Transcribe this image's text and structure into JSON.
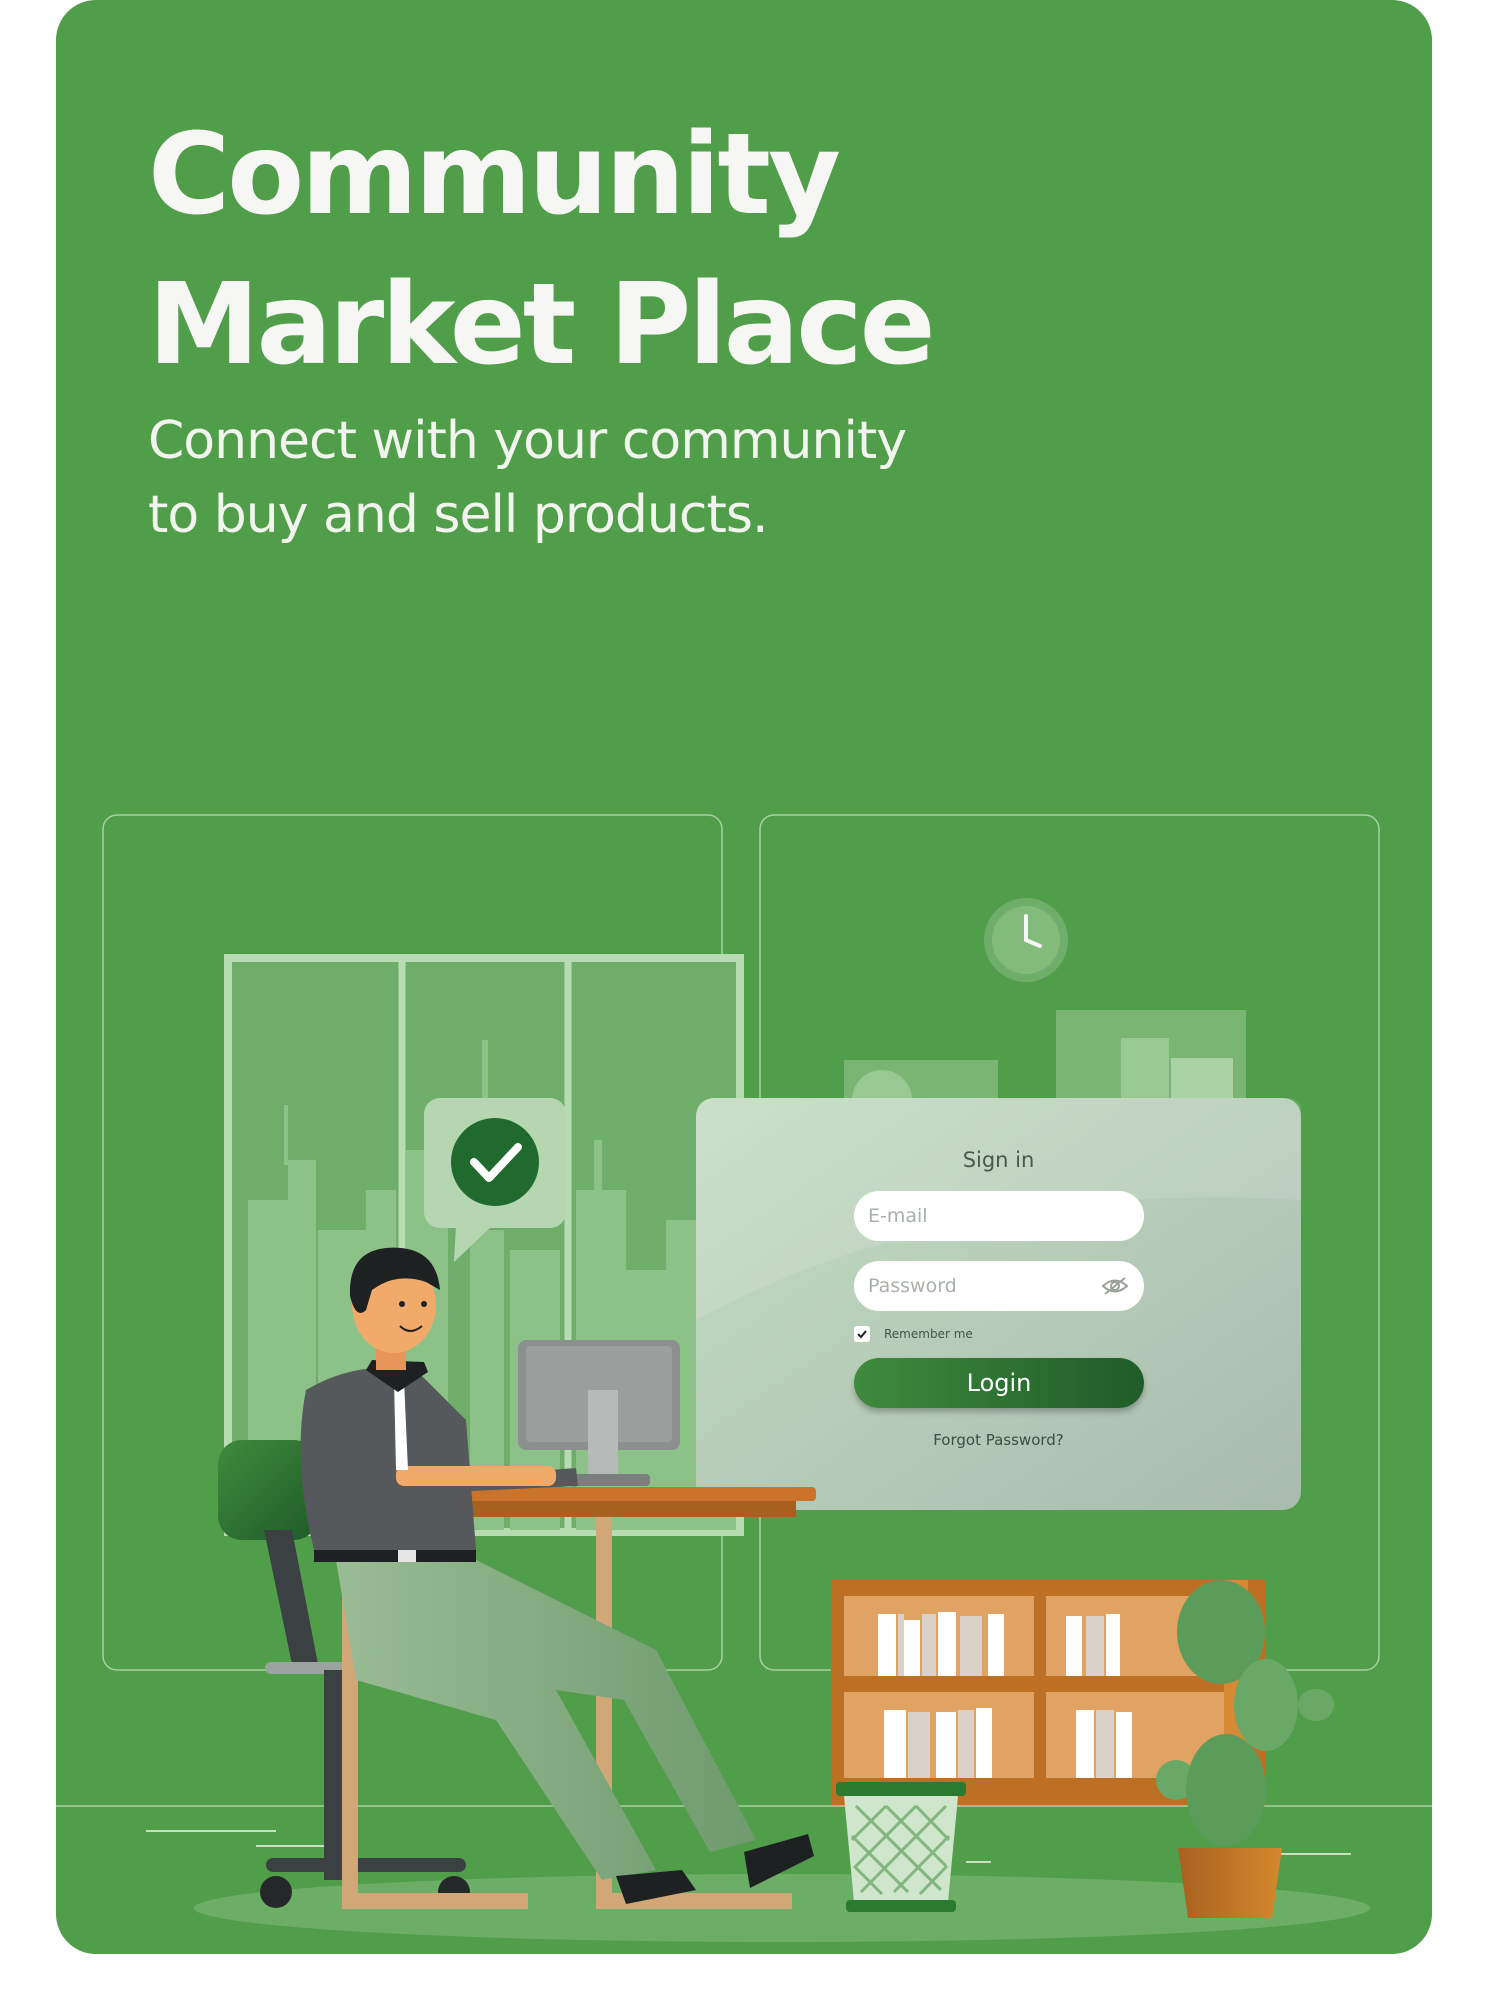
{
  "hero": {
    "title_line1": "Community",
    "title_line2": "Market Place",
    "subtitle_line1": "Connect with your community",
    "subtitle_line2": "to buy and sell products."
  },
  "login_form": {
    "title": "Sign in",
    "email_placeholder": "E-mail",
    "password_placeholder": "Password",
    "remember_label": "Remember me",
    "remember_checked": true,
    "login_label": "Login",
    "forgot_label": "Forgot Password?"
  },
  "colors": {
    "brand_green": "#519e4a",
    "button_green": "#2e7533",
    "text_light": "#f6f7f4"
  },
  "icons": [
    "check-icon",
    "clock-icon",
    "eye-slash-icon",
    "checkbox-check-icon"
  ]
}
